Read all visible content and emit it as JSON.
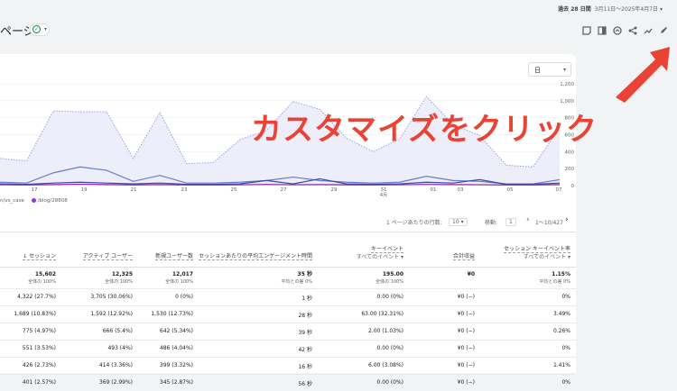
{
  "header": {
    "date_prefix": "過去 28 日間",
    "date_range": "3月11日～2025年4月7日",
    "date_caret": "▾",
    "title": "ページ",
    "title_check": "✓",
    "title_caret": "▾"
  },
  "toolbar": {
    "icons": [
      "report-icon",
      "compare-icon",
      "insights-icon",
      "share-icon",
      "trend-icon",
      "edit-icon"
    ]
  },
  "chart": {
    "granularity": "日",
    "granularity_caret": "▾",
    "legend_clip": "n/vs_case",
    "legend_item": "/blog/28808"
  },
  "chart_data": {
    "type": "line",
    "x_ticks": [
      "17",
      "19",
      "21",
      "23",
      "25",
      "27",
      "29",
      "31",
      "01",
      "03",
      "05",
      "07"
    ],
    "x_month": "4月",
    "y_ticks": [
      "1,200",
      "1,000",
      "800",
      "600",
      "400",
      "200",
      "0"
    ],
    "ylim": [
      0,
      1200
    ],
    "series": [
      {
        "color": "#9aa0e6",
        "area": true,
        "values": [
          320,
          290,
          880,
          870,
          870,
          320,
          860,
          260,
          270,
          540,
          650,
          990,
          900,
          560,
          400,
          550,
          1050,
          720,
          590,
          240,
          220,
          680
        ]
      },
      {
        "color": "#5e7fc8",
        "values": [
          40,
          30,
          150,
          220,
          180,
          50,
          120,
          30,
          30,
          40,
          60,
          100,
          60,
          40,
          30,
          40,
          110,
          60,
          50,
          20,
          20,
          70
        ]
      },
      {
        "color": "#3b4a9e",
        "values": [
          20,
          15,
          30,
          40,
          30,
          20,
          30,
          15,
          15,
          20,
          60,
          20,
          80,
          20,
          15,
          20,
          40,
          30,
          70,
          15,
          15,
          30
        ]
      },
      {
        "color": "#8e24aa",
        "values": [
          10,
          8,
          12,
          15,
          12,
          8,
          12,
          8,
          8,
          10,
          14,
          10,
          12,
          9,
          8,
          10,
          14,
          12,
          10,
          8,
          8,
          12
        ]
      }
    ]
  },
  "pager": {
    "rows_label": "1 ページあたりの行数:",
    "rows_value": "10",
    "rows_caret": "▾",
    "move_label": "移動:",
    "move_value": "1",
    "prev": "‹",
    "range": "1～10/427",
    "next": "›"
  },
  "table": {
    "headers": [
      {
        "label": "↓ セッション"
      },
      {
        "label": "アクティブ ユーザー"
      },
      {
        "label": "新規ユーザー数"
      },
      {
        "label": "セッションあたりの平均エンゲージメント時間"
      },
      {
        "label": "キーイベント",
        "sub": "すべてのイベント ▾"
      },
      {
        "label": "合計収益"
      },
      {
        "label": "セッション キーイベント率",
        "sub": "すべてのイベント ▾"
      }
    ],
    "totals": [
      {
        "v": "15,602",
        "s": "全体の 100%"
      },
      {
        "v": "12,325",
        "s": "全体の 100%"
      },
      {
        "v": "12,017",
        "s": "全体の 100%"
      },
      {
        "v": "35 秒",
        "s": "平均との差 0%"
      },
      {
        "v": "195.00",
        "s": "全体の 100%"
      },
      {
        "v": "¥0",
        "s": ""
      },
      {
        "v": "1.15%",
        "s": "平均との差 0%"
      }
    ],
    "rows": [
      [
        "4,322 (27.7%)",
        "3,705 (30.06%)",
        "0 (0%)",
        "1 秒",
        "0.00 (0%)",
        "¥0 (−)",
        "0%"
      ],
      [
        "1,689 (10.83%)",
        "1,592 (12.92%)",
        "1,530 (12.73%)",
        "28 秒",
        "63.00 (32.31%)",
        "¥0 (−)",
        "3.49%"
      ],
      [
        "775 (4.97%)",
        "666 (5.4%)",
        "642 (5.34%)",
        "39 秒",
        "2.00 (1.03%)",
        "¥0 (−)",
        "0.26%"
      ],
      [
        "551 (3.53%)",
        "493 (4%)",
        "486 (4.04%)",
        "42 秒",
        "0.00 (0%)",
        "¥0 (−)",
        "0%"
      ],
      [
        "426 (2.73%)",
        "414 (3.36%)",
        "399 (3.32%)",
        "16 秒",
        "6.00 (3.08%)",
        "¥0 (−)",
        "1.41%"
      ],
      [
        "401 (2.57%)",
        "369 (2.99%)",
        "345 (2.87%)",
        "56 秒",
        "0.00 (0%)",
        "¥0 (−)",
        "0%"
      ]
    ]
  },
  "annotation": {
    "text": "カスタマイズをクリック",
    "color": "#ea4335"
  }
}
